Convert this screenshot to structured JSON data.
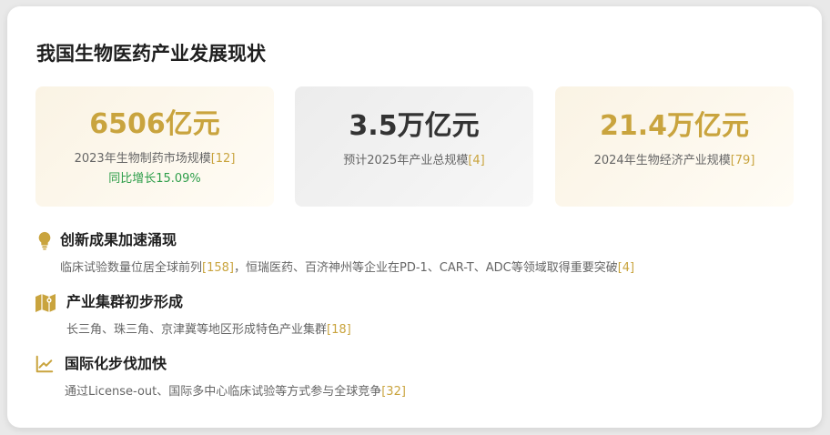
{
  "title": "我国生物医药产业发展现状",
  "stats": [
    {
      "value": "6506亿元",
      "desc": "2023年生物制药市场规模",
      "ref": "[12]",
      "sub": "同比增长15.09%"
    },
    {
      "value": "3.5万亿元",
      "desc": "预计2025年产业总规模",
      "ref": "[4]"
    },
    {
      "value": "21.4万亿元",
      "desc": "2024年生物经济产业规模",
      "ref": "[79]"
    }
  ],
  "items": [
    {
      "icon": "lightbulb-icon",
      "head": "创新成果加速涌现",
      "text1": "临床试验数量位居全球前列",
      "ref1": "[158]",
      "text2": "，恒瑞医药、百济神州等企业在PD-1、CAR-T、ADC等领域取得重要突破",
      "ref2": "[4]"
    },
    {
      "icon": "map-icon",
      "head": "产业集群初步形成",
      "text1": "长三角、珠三角、京津冀等地区形成特色产业集群",
      "ref1": "[18]"
    },
    {
      "icon": "chart-line-icon",
      "head": "国际化步伐加快",
      "text1": "通过License-out、国际多中心临床试验等方式参与全球竞争",
      "ref1": "[32]"
    }
  ],
  "colors": {
    "accent": "#c9a43e",
    "growth": "#2e9e4a"
  }
}
